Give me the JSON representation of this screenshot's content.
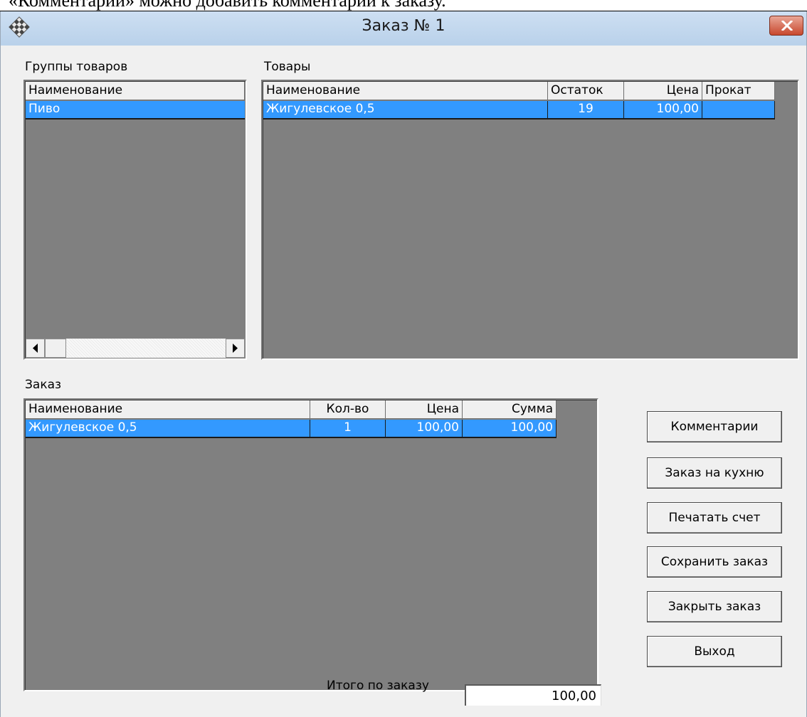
{
  "document": {
    "caption_fragment": "«Комментарии» можно добавить комментарии к заказу."
  },
  "window": {
    "title": "Заказ № 1",
    "app_icon": "chessboard-app-icon",
    "close_icon": "close-x-icon"
  },
  "groups": {
    "label": "Группы товаров",
    "columns": [
      "Наименование"
    ],
    "rows": [
      {
        "name": "Пиво"
      }
    ],
    "scroll_icons": [
      "arrow-left-icon",
      "arrow-right-icon"
    ]
  },
  "products": {
    "label": "Товары",
    "columns": [
      "Наименование",
      "Остаток",
      "Цена",
      "Прокат"
    ],
    "rows": [
      {
        "name": "Жигулевское 0,5",
        "stock": "19",
        "price": "100,00",
        "rental": ""
      }
    ]
  },
  "order": {
    "label": "Заказ",
    "columns": [
      "Наименование",
      "Кол-во",
      "Цена",
      "Сумма"
    ],
    "rows": [
      {
        "name": "Жигулевское 0,5",
        "qty": "1",
        "price": "100,00",
        "sum": "100,00"
      }
    ]
  },
  "buttons": {
    "comments": "Комментарии",
    "kitchen": "Заказ на кухню",
    "print_bill": "Печатать счет",
    "save_order": "Сохранить заказ",
    "close_order": "Закрыть заказ",
    "exit": "Выход"
  },
  "total": {
    "label": "Итого по заказу",
    "value": "100,00"
  },
  "colors": {
    "selection": "#3399ff",
    "grid_bg": "#808080",
    "titlebar": "#c5dbf1",
    "close_button": "#c8482e"
  }
}
